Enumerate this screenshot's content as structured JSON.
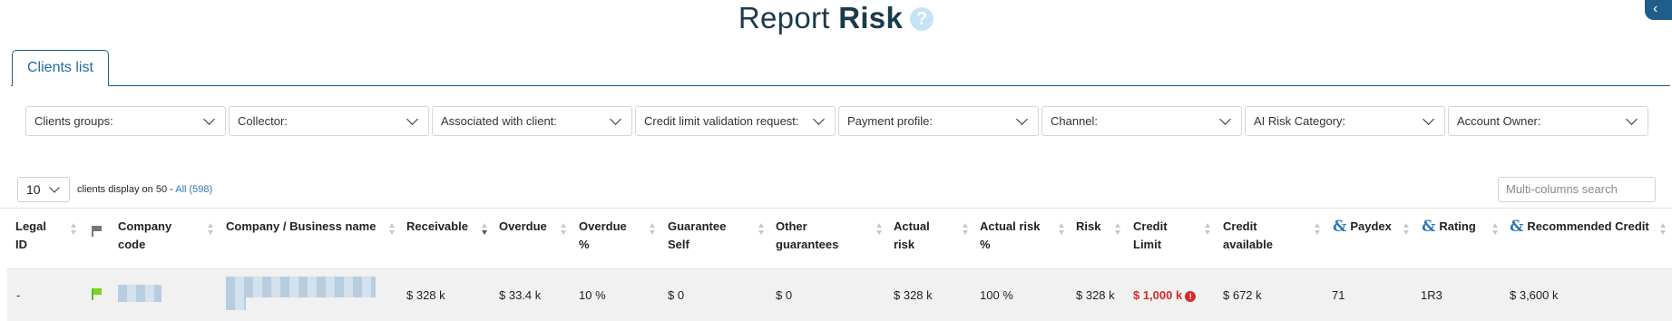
{
  "header": {
    "title_light": "Report",
    "title_bold": "Risk",
    "help_icon": "question-circle-icon",
    "corner_icon": "chevron-left-icon"
  },
  "tabs": [
    {
      "label": "Clients list",
      "active": true
    }
  ],
  "filters": [
    {
      "label": "Clients groups:"
    },
    {
      "label": "Collector:"
    },
    {
      "label": "Associated with client:"
    },
    {
      "label": "Credit limit validation request:"
    },
    {
      "label": "Payment profile:"
    },
    {
      "label": "Channel:"
    },
    {
      "label": "AI Risk Category:"
    },
    {
      "label": "Account Owner:"
    }
  ],
  "pager": {
    "page_size": "10",
    "info": "clients display on 50 -",
    "all_link": "All (598)"
  },
  "search": {
    "placeholder": "Multi-columns search"
  },
  "table": {
    "columns": {
      "legal_id": [
        "Legal",
        "ID"
      ],
      "flag": "flag-icon",
      "company_code": [
        "Company",
        "code"
      ],
      "company_name": "Company / Business name",
      "receivable": "Receivable",
      "overdue": "Overdue",
      "overdue_pct": [
        "Overdue",
        "%"
      ],
      "guarantee_self": [
        "Guarantee",
        "Self"
      ],
      "other_guarantees": [
        "Other",
        "guarantees"
      ],
      "actual_risk": [
        "Actual",
        "risk"
      ],
      "actual_risk_pct": [
        "Actual risk",
        "%"
      ],
      "risk": "Risk",
      "credit_limit": [
        "Credit",
        "Limit"
      ],
      "credit_available": [
        "Credit",
        "available"
      ],
      "paydex": "Paydex",
      "rating": "Rating",
      "recommended_credit": "Recommended Credit"
    },
    "rows": [
      {
        "legal_id": "-",
        "flag_color": "#7ed321",
        "receivable": "$ 328 k",
        "overdue": "$ 33.4 k",
        "overdue_pct": "10 %",
        "guarantee_self": "$ 0",
        "other_guarantees": "$ 0",
        "actual_risk": "$ 328 k",
        "actual_risk_pct": "100 %",
        "risk": "$ 328 k",
        "credit_limit": "$ 1,000 k",
        "credit_limit_warning": "!",
        "credit_available": "$ 672 k",
        "paydex": "71",
        "rating": "1R3",
        "recommended_credit": "$ 3,600 k"
      }
    ]
  },
  "colors": {
    "accent": "#1f6aa0",
    "title": "#1b3a4b",
    "danger": "#d22b2b",
    "flag_green": "#7ed321"
  }
}
